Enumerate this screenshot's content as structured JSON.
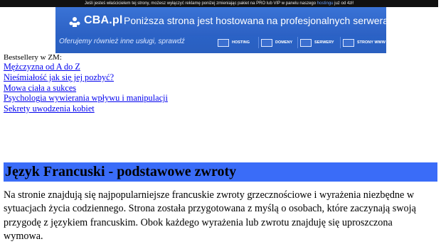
{
  "top_strip": {
    "text_before": "Jeśli jesteś właścicielem tej strony, możesz wyłączyć reklamę poniżej zmieniając pakiet na PRO lub VIP w panelu naszego",
    "link": "hostingu",
    "text_after": "już od 4zł!"
  },
  "banner": {
    "logo": "CBA.pl",
    "headline": "Poniższa strona jest hostowana na profesjonalnych serwerach CBA.pl",
    "subline": "Oferujemy również inne usługi, sprawdź",
    "services": [
      "HOSTING",
      "DOMENY",
      "SERWERY",
      "STRONY WWW"
    ]
  },
  "bestsellers": {
    "label": "Bestsellery w ZM:",
    "links": [
      "Mężczyzna od A do Z",
      "Nieśmiałość jak się jej pozbyć?",
      "Mowa ciała a sukces",
      "Psychologia wywierania wpływu i manipulacji",
      "Sekrety uwodzenia kobiet"
    ]
  },
  "page": {
    "title": "Język Francuski - podstawowe zwroty",
    "intro": "Na stronie znajdują się najpopularniejsze francuskie zwroty grzecznościowe i wyrażenia niezbędne w sytuacjach życia codziennego. Strona została przygotowana z myślą o osobach, które zaczynają swoją przygodę z językiem francuskim. Obok każdego wyrażenia lub zwrotu znajduję się uproszczona wymowa."
  },
  "colors": {
    "title_bar": "#3a6cf8",
    "banner": "#2b64c9",
    "link": "#0000ee"
  }
}
